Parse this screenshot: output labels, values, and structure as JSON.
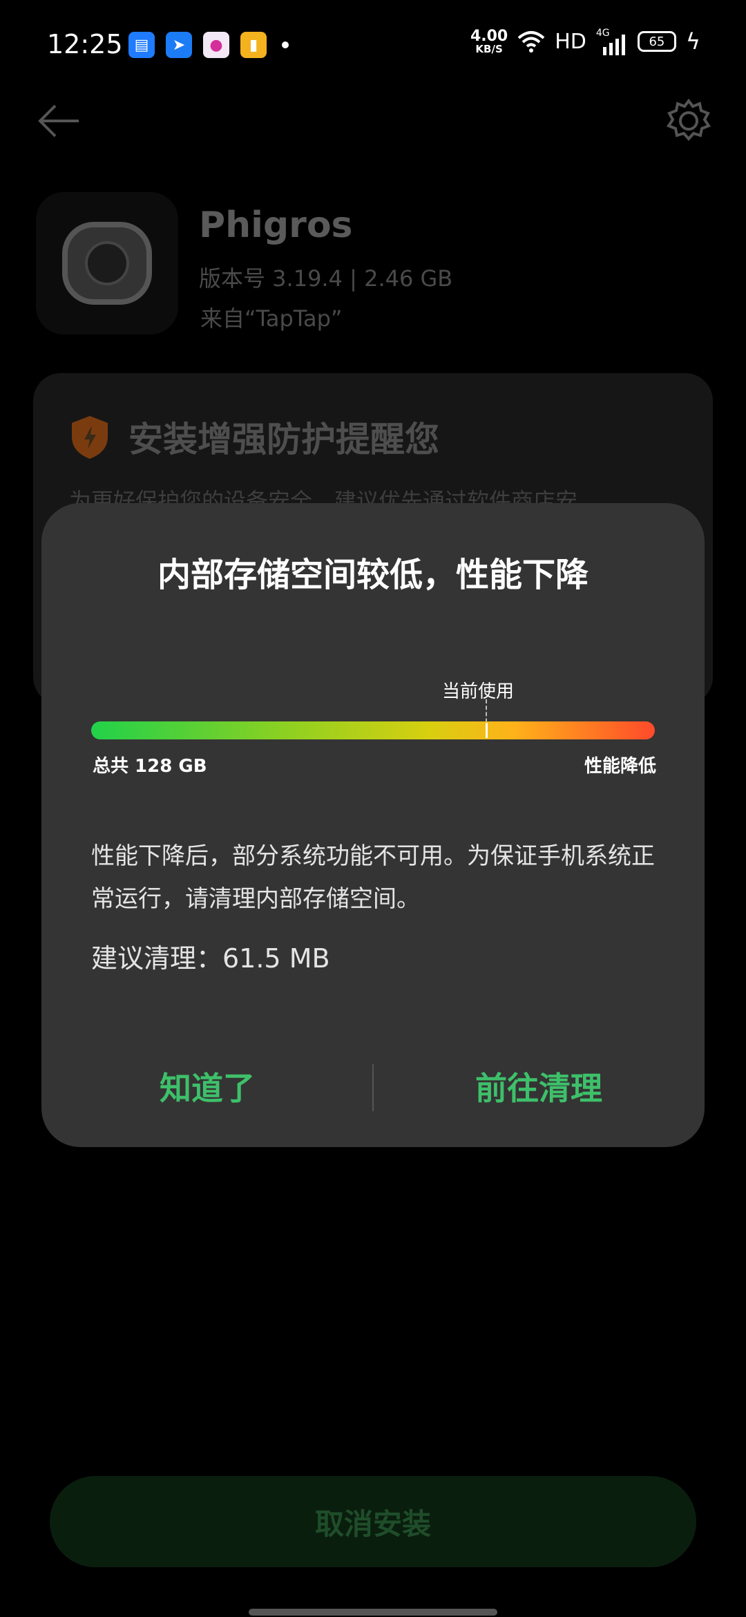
{
  "status_bar": {
    "time": "12:25",
    "net_speed_value": "4.00",
    "net_speed_unit": "KB/S",
    "hd_label": "HD",
    "signal_tag": "4G",
    "battery_level": "65"
  },
  "app": {
    "name": "Phigros",
    "version_size": "版本号 3.19.4 | 2.46 GB",
    "source": "来自“TapTap”"
  },
  "protection": {
    "title": "安装增强防护提醒您",
    "description": "为更好保护您的设备安全，建议优先通过软件商店安"
  },
  "dialog": {
    "title": "内部存储空间较低，性能下降",
    "current_usage_label": "当前使用",
    "usage_fraction": 0.7,
    "total_label": "总共 128 GB",
    "performance_label": "性能降低",
    "description": "性能下降后，部分系统功能不可用。为保证手机系统正常运行，请清理内部存储空间。",
    "suggestion": "建议清理：61.5 MB",
    "ok_button": "知道了",
    "clean_button": "前往清理"
  },
  "cancel_install": "取消安装",
  "colors": {
    "accent_green": "#3ec06a",
    "dialog_bg": "#343434",
    "shield_orange": "#e0761c"
  }
}
